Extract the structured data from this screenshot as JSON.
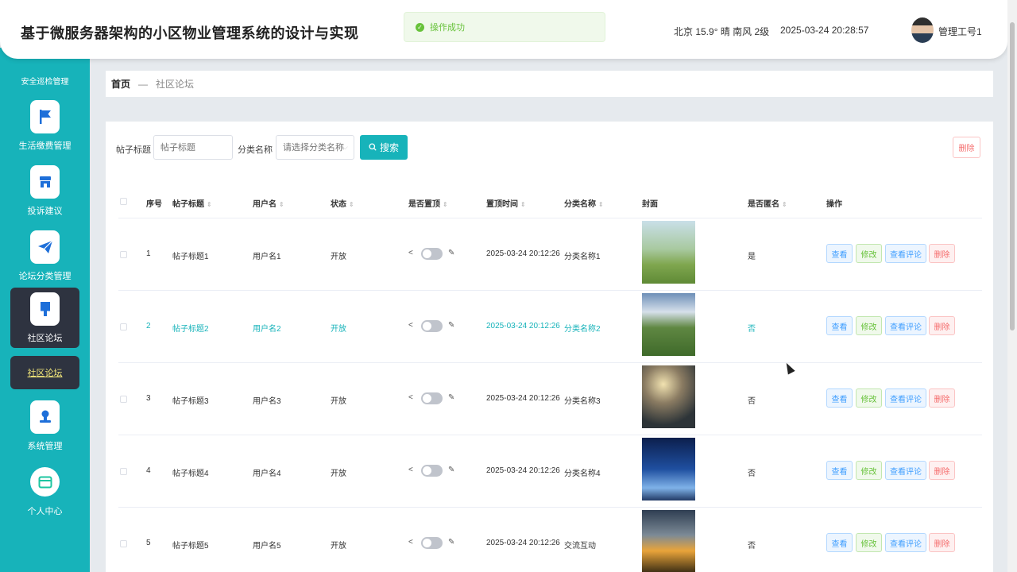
{
  "header": {
    "title": "基于微服务器架构的小区物业管理系统的设计与实现",
    "toast": "操作成功",
    "weather": "北京 15.9° 晴 南风 2级",
    "datetime": "2025-03-24 20:28:57",
    "user": "管理工号1"
  },
  "sidebar": {
    "cut_label": "安全巡检管理",
    "items": [
      {
        "label": "生活缴费管理",
        "icon": "flag-icon"
      },
      {
        "label": "投诉建议",
        "icon": "store-icon"
      },
      {
        "label": "论坛分类管理",
        "icon": "paper-plane-icon"
      },
      {
        "label": "社区论坛",
        "icon": "brush-icon"
      },
      {
        "label": "系统管理",
        "icon": "user-stamp-icon"
      },
      {
        "label": "个人中心",
        "icon": "card-icon"
      }
    ],
    "sub_item": "社区论坛"
  },
  "breadcrumb": {
    "home": "首页",
    "sep": "—",
    "current": "社区论坛"
  },
  "search": {
    "title_label": "帖子标题",
    "title_placeholder": "帖子标题",
    "category_label": "分类名称",
    "category_placeholder": "请选择分类名称",
    "button": "搜索",
    "delete": "删除"
  },
  "table": {
    "columns": [
      "序号",
      "帖子标题",
      "用户名",
      "状态",
      "是否置顶",
      "置顶时间",
      "分类名称",
      "封面",
      "是否匿名",
      "操作"
    ],
    "actions": {
      "view": "查看",
      "edit": "修改",
      "comment": "查看评论",
      "delete": "删除"
    },
    "rows": [
      {
        "no": "1",
        "title": "帖子标题1",
        "user": "用户名1",
        "status": "开放",
        "time": "2025-03-24 20:12:26",
        "category": "分类名称1",
        "anonymous": "是"
      },
      {
        "no": "2",
        "title": "帖子标题2",
        "user": "用户名2",
        "status": "开放",
        "time": "2025-03-24 20:12:26",
        "category": "分类名称2",
        "anonymous": "否"
      },
      {
        "no": "3",
        "title": "帖子标题3",
        "user": "用户名3",
        "status": "开放",
        "time": "2025-03-24 20:12:26",
        "category": "分类名称3",
        "anonymous": "否"
      },
      {
        "no": "4",
        "title": "帖子标题4",
        "user": "用户名4",
        "status": "开放",
        "time": "2025-03-24 20:12:26",
        "category": "分类名称4",
        "anonymous": "否"
      },
      {
        "no": "5",
        "title": "帖子标题5",
        "user": "用户名5",
        "status": "开放",
        "time": "2025-03-24 20:12:26",
        "category": "交流互动",
        "anonymous": "否"
      }
    ]
  },
  "colors": {
    "accent": "#17b3ba",
    "sidebar_active": "#2e3340",
    "danger": "#f56c6c",
    "primary": "#409eff",
    "success": "#67c23a"
  }
}
